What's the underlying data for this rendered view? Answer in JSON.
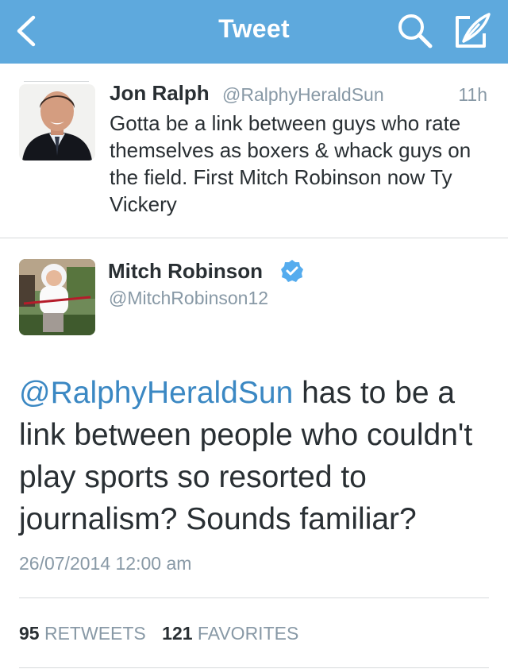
{
  "navbar": {
    "title": "Tweet",
    "back_icon": "chevron-left-icon",
    "search_icon": "search-icon",
    "compose_icon": "compose-icon",
    "background": "#5ea9dd"
  },
  "in_reply_to": {
    "name": "Jon Ralph",
    "handle": "@RalphyHeraldSun",
    "time": "11h",
    "text": "Gotta be a link between guys who rate themselves as boxers & whack guys on the field. First Mitch Robinson now Ty Vickery"
  },
  "tweet": {
    "name": "Mitch Robinson",
    "verified": true,
    "handle": "@MitchRobinson12",
    "mention": "@RalphyHeraldSun",
    "text_after_mention": " has to be a link between people who couldn't play sports so resorted to journalism? Sounds familiar?",
    "date": "26/07/2014 12:00 am",
    "retweets_count": "95",
    "retweets_label": "RETWEETS",
    "favorites_count": "121",
    "favorites_label": "FAVORITES"
  },
  "colors": {
    "accent": "#5ea9dd",
    "link": "#3b88c3",
    "secondary_text": "#8899a6",
    "verified": "#55acee"
  }
}
